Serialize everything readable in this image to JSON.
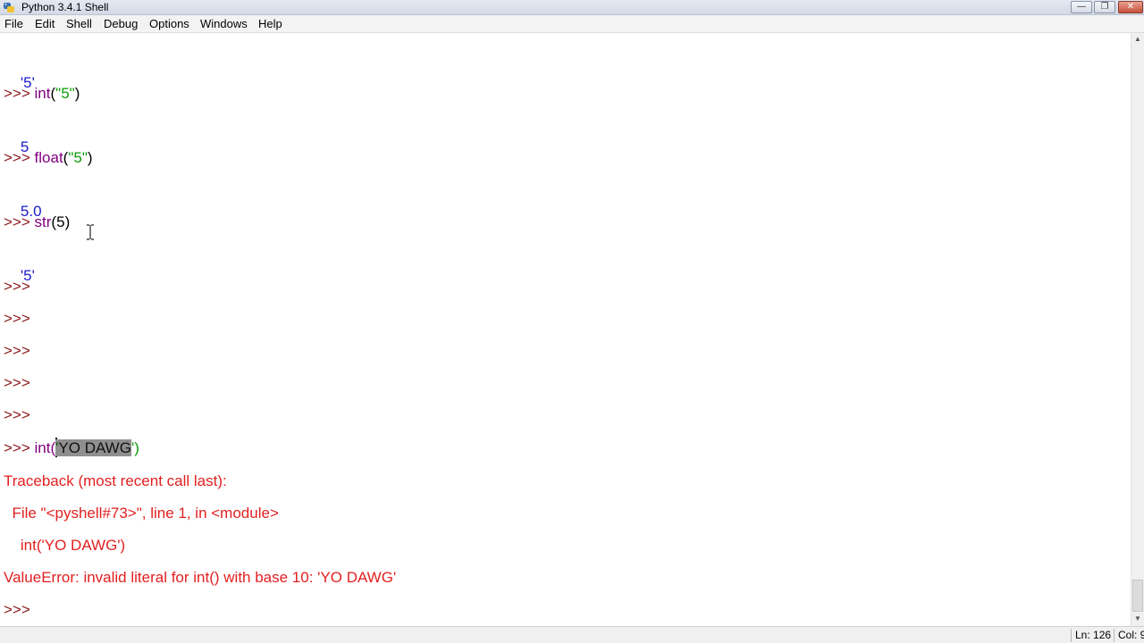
{
  "window": {
    "title": "Python 3.4.1 Shell",
    "buttons": {
      "minimize": "—",
      "maximize": "❐",
      "close": "✕"
    }
  },
  "menu": [
    "File",
    "Edit",
    "Shell",
    "Debug",
    "Options",
    "Windows",
    "Help"
  ],
  "shell": {
    "prompt": ">>>",
    "lines": [
      {
        "out": "'5'"
      },
      {
        "cmd": {
          "fn": "int",
          "open": "(",
          "arg": "\"5\"",
          "close": ")"
        }
      },
      {
        "out": "5"
      },
      {
        "cmd": {
          "fn": "float",
          "open": "(",
          "arg": "\"5\"",
          "close": ")"
        }
      },
      {
        "out": "5.0"
      },
      {
        "cmd": {
          "fn": "str",
          "open": "(",
          "arg": "5",
          "close": ")"
        }
      },
      {
        "out": "'5'"
      },
      {
        "cmd": {
          "open": "int(",
          "quote": "'",
          "selected": "YO DAWG",
          "close": "')"
        }
      },
      {
        "err": [
          "Traceback (most recent call last):",
          "  File \"<pyshell#73>\", line 1, in <module>",
          "    int('YO DAWG')",
          "ValueError: invalid literal for int() with base 10: 'YO DAWG'"
        ]
      }
    ]
  },
  "status": {
    "line": "Ln: 126",
    "col": "Col: 9"
  },
  "colors": {
    "prompt": "#8b1a1a",
    "builtin": "#800080",
    "string": "#0a9a0a",
    "output": "#1a1acc",
    "error": "#e22020",
    "selection": "#8f8f8f"
  },
  "icons": [
    "python-app-icon",
    "text-cursor-ibeam-icon",
    "scroll-up-icon",
    "scroll-down-icon"
  ]
}
